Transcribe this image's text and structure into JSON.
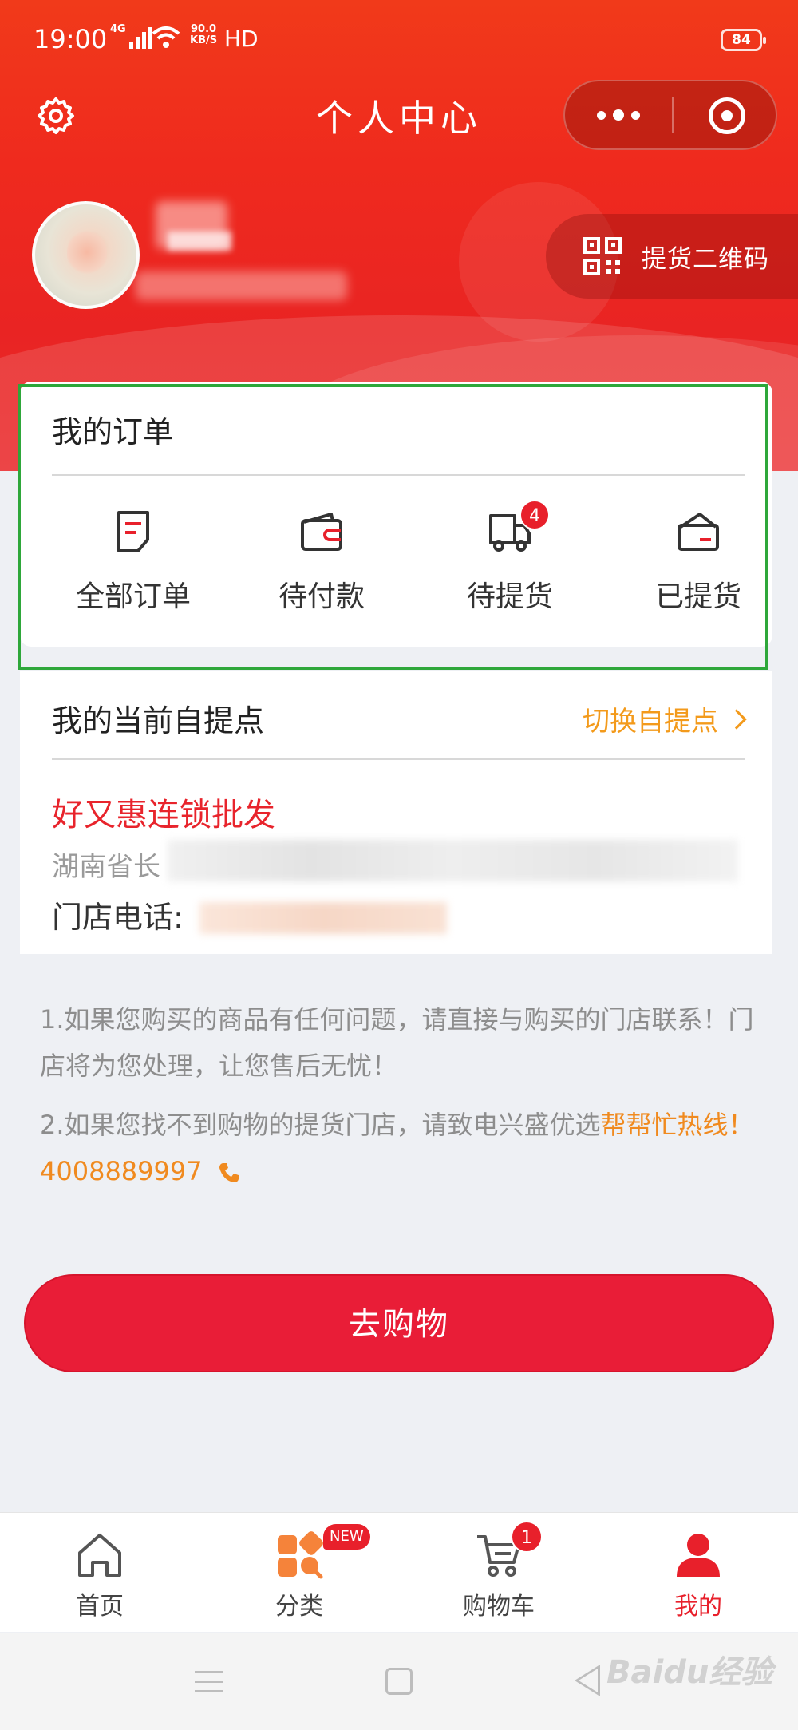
{
  "status_bar": {
    "time": "19:00",
    "network": "4G",
    "speed_value": "90.0",
    "speed_unit": "KB/S",
    "hd": "HD",
    "battery": "84"
  },
  "header": {
    "title": "个人中心",
    "pickup_qr_label": "提货二维码"
  },
  "orders": {
    "title": "我的订单",
    "items": [
      {
        "label": "全部订单",
        "icon": "document-icon"
      },
      {
        "label": "待付款",
        "icon": "wallet-icon"
      },
      {
        "label": "待提货",
        "icon": "truck-icon",
        "badge": "4"
      },
      {
        "label": "已提货",
        "icon": "box-icon"
      }
    ]
  },
  "pickup_point": {
    "title": "我的当前自提点",
    "switch_label": "切换自提点",
    "store_name": "好又惠连锁批发",
    "address_prefix": "湖南省长",
    "phone_label": "门店电话:"
  },
  "notes": {
    "line1": "1.如果您购买的商品有任何问题，请直接与购买的门店联系！门店将为您处理，让您售后无忧！",
    "line2_prefix": "2.如果您找不到购物的提货门店，请致电兴盛优选",
    "line2_highlight": "帮帮忙热线！",
    "hotline": "4008889997"
  },
  "go_shopping": "去购物",
  "tabbar": {
    "items": [
      {
        "label": "首页",
        "icon": "home-icon"
      },
      {
        "label": "分类",
        "icon": "category-icon",
        "tag": "NEW"
      },
      {
        "label": "购物车",
        "icon": "cart-icon",
        "badge": "1"
      },
      {
        "label": "我的",
        "icon": "profile-icon",
        "active": true
      }
    ]
  },
  "watermark": "Baidu经验",
  "colors": {
    "brand_red": "#e8202b",
    "accent_orange": "#f39a1b",
    "highlight_outline": "#2ea73a"
  }
}
